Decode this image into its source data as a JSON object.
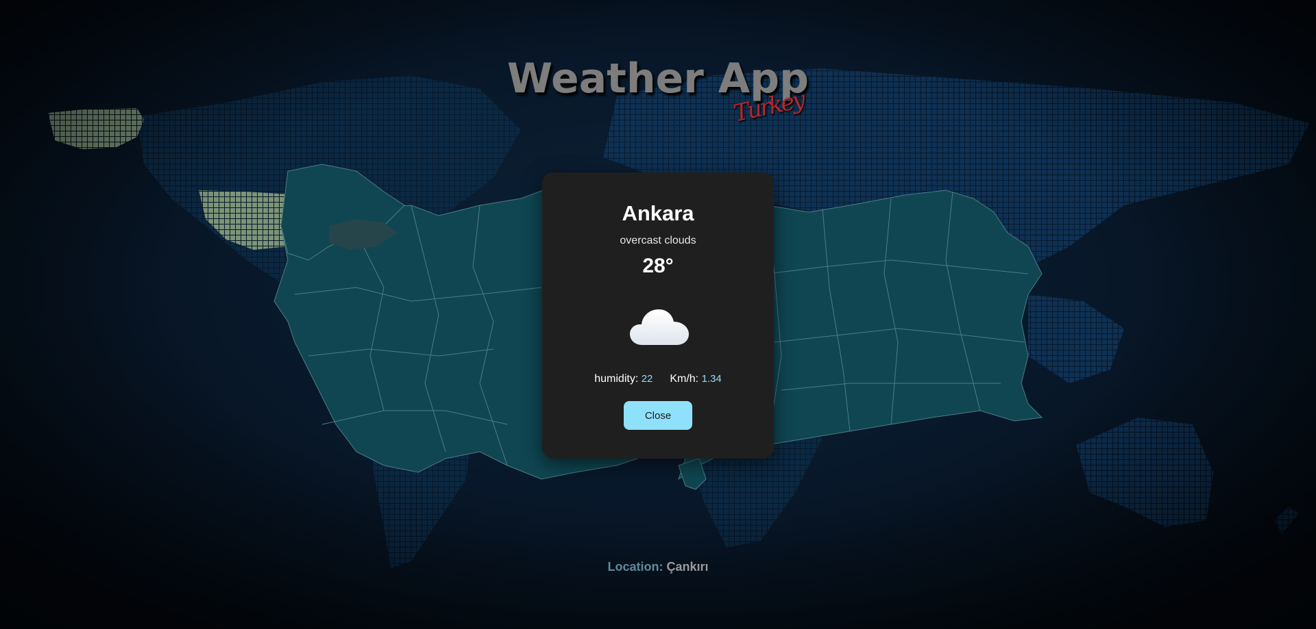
{
  "app": {
    "title": "Weather App",
    "subtitle": "Turkey"
  },
  "weather_modal": {
    "city": "Ankara",
    "description": "overcast clouds",
    "temperature": "28°",
    "icon": "cloud-icon",
    "humidity_label": "humidity:",
    "humidity_value": "22",
    "wind_label": "Km/h:",
    "wind_value": "1.34",
    "close_label": "Close"
  },
  "footer": {
    "location_label": "Location:",
    "location_value": "Çankırı"
  },
  "colors": {
    "modal_bg": "#1f1f1f",
    "accent": "#8fe0fb",
    "map_fill": "#0f4652",
    "world_dots": "#0d2c4c",
    "subtitle": "#b0282a"
  }
}
